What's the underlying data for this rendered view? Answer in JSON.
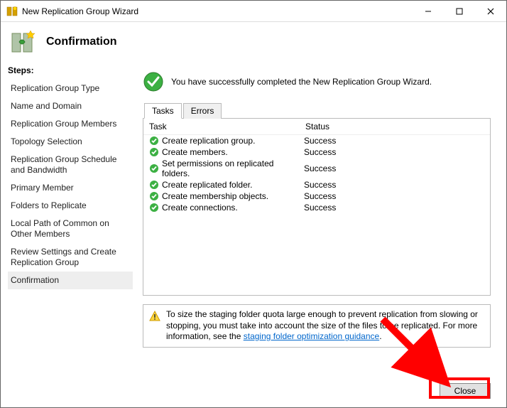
{
  "window": {
    "title": "New Replication Group Wizard"
  },
  "header": {
    "heading": "Confirmation"
  },
  "sidebar": {
    "label": "Steps:",
    "items": [
      "Replication Group Type",
      "Name and Domain",
      "Replication Group Members",
      "Topology Selection",
      "Replication Group Schedule and Bandwidth",
      "Primary Member",
      "Folders to Replicate",
      "Local Path of Common on Other Members",
      "Review Settings and Create Replication Group",
      "Confirmation"
    ],
    "selected_index": 9
  },
  "success_message": "You have successfully completed the New Replication Group Wizard.",
  "tabs": {
    "items": [
      "Tasks",
      "Errors"
    ],
    "active_index": 0
  },
  "task_table": {
    "columns": {
      "task": "Task",
      "status": "Status"
    },
    "rows": [
      {
        "task": "Create replication group.",
        "status": "Success"
      },
      {
        "task": "Create members.",
        "status": "Success"
      },
      {
        "task": "Set permissions on replicated folders.",
        "status": "Success"
      },
      {
        "task": "Create replicated folder.",
        "status": "Success"
      },
      {
        "task": "Create membership objects.",
        "status": "Success"
      },
      {
        "task": "Create connections.",
        "status": "Success"
      }
    ]
  },
  "note": {
    "text_before_link": "To size the staging folder quota large enough to prevent replication from slowing or stopping, you must take into account the size of the files to be replicated. For more information, see the ",
    "link_text": "staging folder optimization guidance",
    "text_after_link": "."
  },
  "buttons": {
    "close": "Close"
  }
}
